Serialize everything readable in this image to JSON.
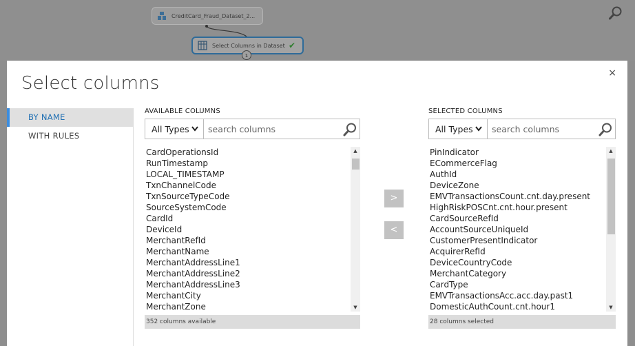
{
  "canvas": {
    "dataset_node_label": "CreditCard_Fraud_Dataset_2...",
    "module_node_label": "Select Columns in Dataset",
    "port_label": "1"
  },
  "dialog": {
    "title": "Select columns",
    "close_label": "×"
  },
  "sidebar": {
    "items": [
      {
        "label": "BY NAME"
      },
      {
        "label": "WITH RULES"
      }
    ]
  },
  "available": {
    "header": "AVAILABLE COLUMNS",
    "type_filter": "All Types",
    "search_placeholder": "search columns",
    "items": [
      "CardOperationsId",
      "RunTimestamp",
      "LOCAL_TIMESTAMP",
      "TxnChannelCode",
      "TxnSourceTypeCode",
      "SourceSystemCode",
      "CardId",
      "DeviceId",
      "MerchantRefId",
      "MerchantName",
      "MerchantAddressLine1",
      "MerchantAddressLine2",
      "MerchantAddressLine3",
      "MerchantCity",
      "MerchantZone"
    ],
    "count_label": "352 columns available"
  },
  "selected": {
    "header": "SELECTED COLUMNS",
    "type_filter": "All Types",
    "search_placeholder": "search columns",
    "items": [
      "PinIndicator",
      "ECommerceFlag",
      "AuthId",
      "DeviceZone",
      "EMVTransactionsCount.cnt.day.present",
      "HighRiskPOSCnt.cnt.hour.present",
      "CardSourceRefId",
      "AccountSourceUniqueId",
      "CustomerPresentIndicator",
      "AcquirerRefId",
      "DeviceCountryCode",
      "MerchantCategory",
      "CardType",
      "EMVTransactionsAcc.acc.day.past1",
      "DomesticAuthCount.cnt.hour1"
    ],
    "count_label": "28 columns selected"
  },
  "movers": {
    "add_label": ">",
    "remove_label": "<"
  }
}
